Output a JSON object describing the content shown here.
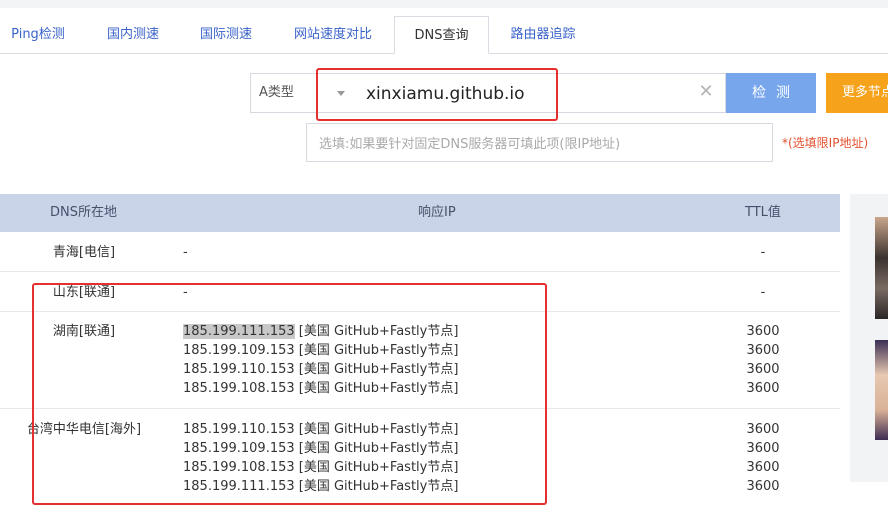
{
  "tabs": [
    {
      "label": "Ping检测",
      "active": false
    },
    {
      "label": "国内测速",
      "active": false
    },
    {
      "label": "国际测速",
      "active": false
    },
    {
      "label": "网站速度对比",
      "active": false
    },
    {
      "label": "DNS查询",
      "active": true
    },
    {
      "label": "路由器追踪",
      "active": false
    }
  ],
  "query": {
    "record_type": "A类型",
    "domain_value": "xinxiamu.github.io",
    "check_button": "检测",
    "more_button": "更多节点",
    "dns_server_placeholder": "选填:如果要针对固定DNS服务器可填此项(限IP地址)",
    "dns_hint": "*(选填限IP地址)"
  },
  "table": {
    "headers": {
      "location": "DNS所在地",
      "ip": "响应IP",
      "ttl": "TTL值"
    },
    "rows": [
      {
        "location": "青海[电信]",
        "ips": [
          "-"
        ],
        "ttls": [
          "-"
        ]
      },
      {
        "location": "山东[联通]",
        "ips": [
          "-"
        ],
        "ttls": [
          "-"
        ]
      },
      {
        "location": "湖南[联通]",
        "ips": [
          "185.199.111.153 [美国 GitHub+Fastly节点]",
          "185.199.109.153 [美国 GitHub+Fastly节点]",
          "185.199.110.153 [美国 GitHub+Fastly节点]",
          "185.199.108.153 [美国 GitHub+Fastly节点]"
        ],
        "ttls": [
          "3600",
          "3600",
          "3600",
          "3600"
        ]
      },
      {
        "location": "台湾中华电信[海外]",
        "ips": [
          "185.199.110.153 [美国 GitHub+Fastly节点]",
          "185.199.109.153 [美国 GitHub+Fastly节点]",
          "185.199.108.153 [美国 GitHub+Fastly节点]",
          "185.199.111.153 [美国 GitHub+Fastly节点]"
        ],
        "ttls": [
          "3600",
          "3600",
          "3600",
          "3600"
        ]
      }
    ]
  },
  "colors": {
    "tab_link": "#3a63c9",
    "check_button": "#77a6ec",
    "more_button": "#f6a21a",
    "table_header": "#c9d4e8",
    "annotation": "#e53030",
    "hint": "#e4502d"
  },
  "icons": {
    "clear": "close-icon",
    "select": "chevron-down-icon"
  }
}
